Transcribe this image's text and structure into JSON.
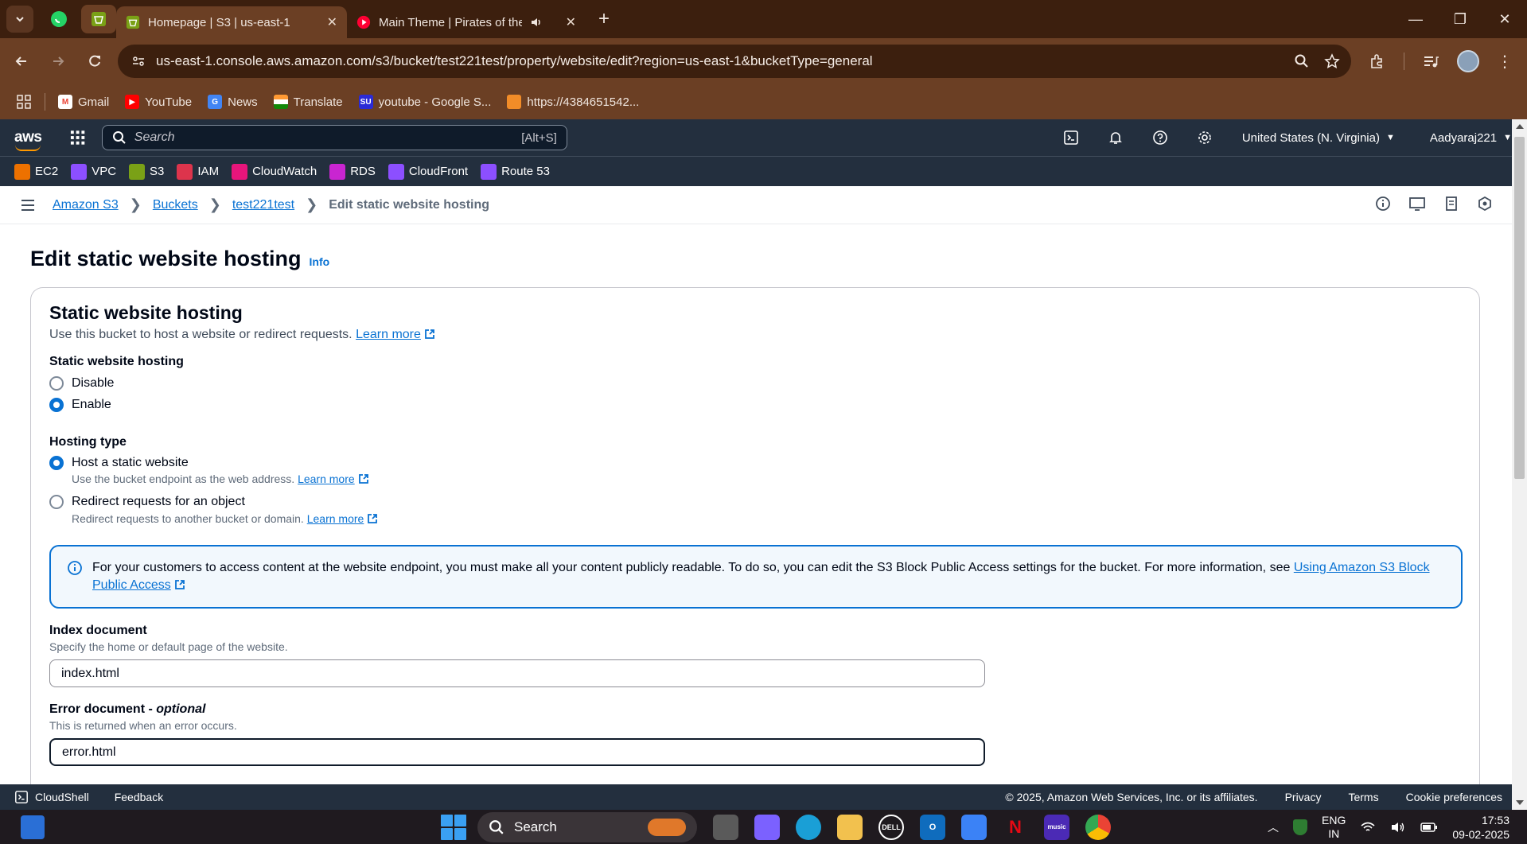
{
  "browser": {
    "tabs": [
      {
        "title": "Homepage | S3 | us-east-1",
        "active": true
      },
      {
        "title": "Main Theme | Pirates of the",
        "active": false
      }
    ],
    "url": "us-east-1.console.aws.amazon.com/s3/bucket/test221test/property/website/edit?region=us-east-1&bucketType=general",
    "bookmarks": [
      "Gmail",
      "YouTube",
      "News",
      "Translate",
      "youtube - Google S...",
      "https://4384651542..."
    ]
  },
  "aws": {
    "logo": "aws",
    "search_placeholder": "Search",
    "search_shortcut": "[Alt+S]",
    "region": "United States (N. Virginia)",
    "user": "Aadyaraj221",
    "services": [
      {
        "label": "EC2",
        "color": "#ed7100"
      },
      {
        "label": "VPC",
        "color": "#8c4fff"
      },
      {
        "label": "S3",
        "color": "#7aa116"
      },
      {
        "label": "IAM",
        "color": "#dd344c"
      },
      {
        "label": "CloudWatch",
        "color": "#e7157b"
      },
      {
        "label": "RDS",
        "color": "#c925d1"
      },
      {
        "label": "CloudFront",
        "color": "#8c4fff"
      },
      {
        "label": "Route 53",
        "color": "#8c4fff"
      }
    ]
  },
  "breadcrumb": {
    "items": [
      "Amazon S3",
      "Buckets",
      "test221test"
    ],
    "current": "Edit static website hosting"
  },
  "page": {
    "title": "Edit static website hosting",
    "info": "Info"
  },
  "panel": {
    "title": "Static website hosting",
    "description": "Use this bucket to host a website or redirect requests.",
    "learn_more": "Learn more",
    "hosting_label": "Static website hosting",
    "hosting_options": [
      {
        "label": "Disable",
        "selected": false
      },
      {
        "label": "Enable",
        "selected": true
      }
    ],
    "hosting_type_label": "Hosting type",
    "hosting_types": [
      {
        "label": "Host a static website",
        "sub": "Use the bucket endpoint as the web address.",
        "selected": true
      },
      {
        "label": "Redirect requests for an object",
        "sub": "Redirect requests to another bucket or domain.",
        "selected": false
      }
    ],
    "alert_text": "For your customers to access content at the website endpoint, you must make all your content publicly readable. To do so, you can edit the S3 Block Public Access settings for the bucket. For more information, see ",
    "alert_link": "Using Amazon S3 Block Public Access",
    "index_label": "Index document",
    "index_hint": "Specify the home or default page of the website.",
    "index_value": "index.html",
    "error_label": "Error document - ",
    "error_optional": "optional",
    "error_hint": "This is returned when an error occurs.",
    "error_value": "error.html"
  },
  "footer": {
    "cloudshell": "CloudShell",
    "feedback": "Feedback",
    "copyright": "© 2025, Amazon Web Services, Inc. or its affiliates.",
    "privacy": "Privacy",
    "terms": "Terms",
    "cookies": "Cookie preferences"
  },
  "taskbar": {
    "search": "Search",
    "lang_top": "ENG",
    "lang_bottom": "IN",
    "time": "17:53",
    "date": "09-02-2025"
  },
  "colors": {
    "accent": "#0972d3",
    "aws_nav": "#232f3e",
    "browser_frame": "#6b3f24"
  }
}
